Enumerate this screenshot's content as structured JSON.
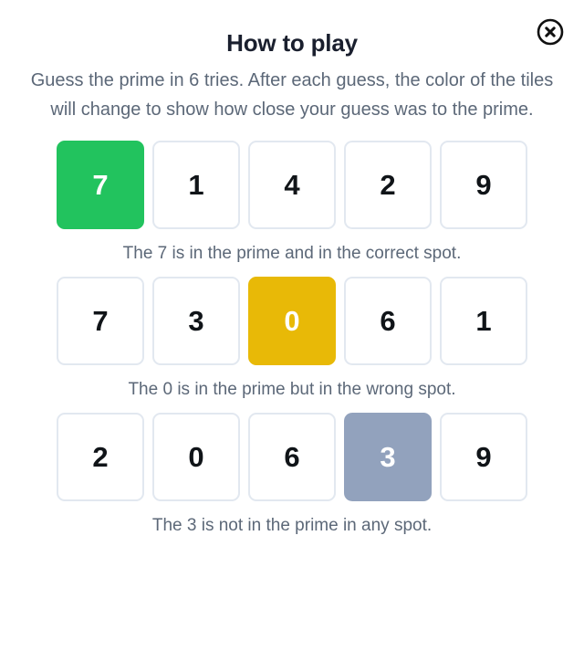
{
  "modal": {
    "title": "How to play",
    "close_label": "close-icon",
    "intro": "Guess the prime in 6 tries. After each guess, the color of the tiles will change to show how close your guess was to the prime.",
    "colors": {
      "correct": "#22c35e",
      "present": "#e8b907",
      "absent": "#92a2bd",
      "tile_border": "#e2e8f0",
      "title_text": "#1a1f2e",
      "body_text": "#5c6878",
      "tile_text": "#101418",
      "background": "#ffffff"
    },
    "examples": [
      {
        "tiles": [
          {
            "letter": "7",
            "state": "correct"
          },
          {
            "letter": "1",
            "state": "empty"
          },
          {
            "letter": "4",
            "state": "empty"
          },
          {
            "letter": "2",
            "state": "empty"
          },
          {
            "letter": "9",
            "state": "empty"
          }
        ],
        "caption": "The 7 is in the prime and in the correct spot."
      },
      {
        "tiles": [
          {
            "letter": "7",
            "state": "empty"
          },
          {
            "letter": "3",
            "state": "empty"
          },
          {
            "letter": "0",
            "state": "present"
          },
          {
            "letter": "6",
            "state": "empty"
          },
          {
            "letter": "1",
            "state": "empty"
          }
        ],
        "caption": "The 0 is in the prime but in the wrong spot."
      },
      {
        "tiles": [
          {
            "letter": "2",
            "state": "empty"
          },
          {
            "letter": "0",
            "state": "empty"
          },
          {
            "letter": "6",
            "state": "empty"
          },
          {
            "letter": "3",
            "state": "absent"
          },
          {
            "letter": "9",
            "state": "empty"
          }
        ],
        "caption": "The 3 is not in the prime in any spot."
      }
    ]
  }
}
